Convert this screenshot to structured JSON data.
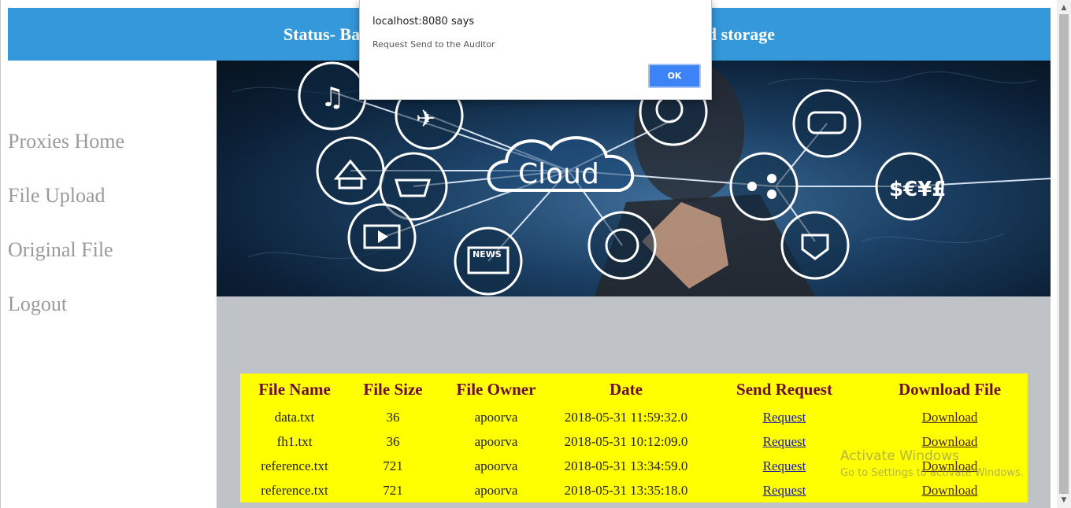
{
  "header": {
    "title_left": "Status- Bas",
    "title_right": "ud storage"
  },
  "sidebar": {
    "items": [
      {
        "label": "Proxies Home"
      },
      {
        "label": "File Upload"
      },
      {
        "label": "Original File"
      },
      {
        "label": "Logout"
      }
    ]
  },
  "banner": {
    "cloud_text": "Cloud",
    "news_text": "NEWS",
    "currency_text": "$€¥£"
  },
  "table": {
    "headers": [
      "File Name",
      "File Size",
      "File Owner",
      "Date",
      "Send Request",
      "Download File"
    ],
    "rows": [
      {
        "name": "data.txt",
        "size": "36",
        "owner": "apoorva",
        "date": "2018-05-31 11:59:32.0",
        "request": "Request",
        "download": "Download"
      },
      {
        "name": "fh1.txt",
        "size": "36",
        "owner": "apoorva",
        "date": "2018-05-31 10:12:09.0",
        "request": "Request",
        "download": "Download"
      },
      {
        "name": "reference.txt",
        "size": "721",
        "owner": "apoorva",
        "date": "2018-05-31 13:34:59.0",
        "request": "Request",
        "download": "Download"
      },
      {
        "name": "reference.txt",
        "size": "721",
        "owner": "apoorva",
        "date": "2018-05-31 13:35:18.0",
        "request": "Request",
        "download": "Download"
      }
    ]
  },
  "dialog": {
    "title": "localhost:8080 says",
    "message": "Request Send to the Auditor",
    "ok_label": "OK"
  },
  "watermark": {
    "line1": "Activate Windows",
    "line2": "Go to Settings to activate Windows."
  },
  "colors": {
    "header_bg": "#3498db",
    "table_bg": "#ffff00",
    "table_header_text": "#6b0d2e",
    "content_bg": "#bfc3c8",
    "ok_button": "#3b83f6"
  }
}
